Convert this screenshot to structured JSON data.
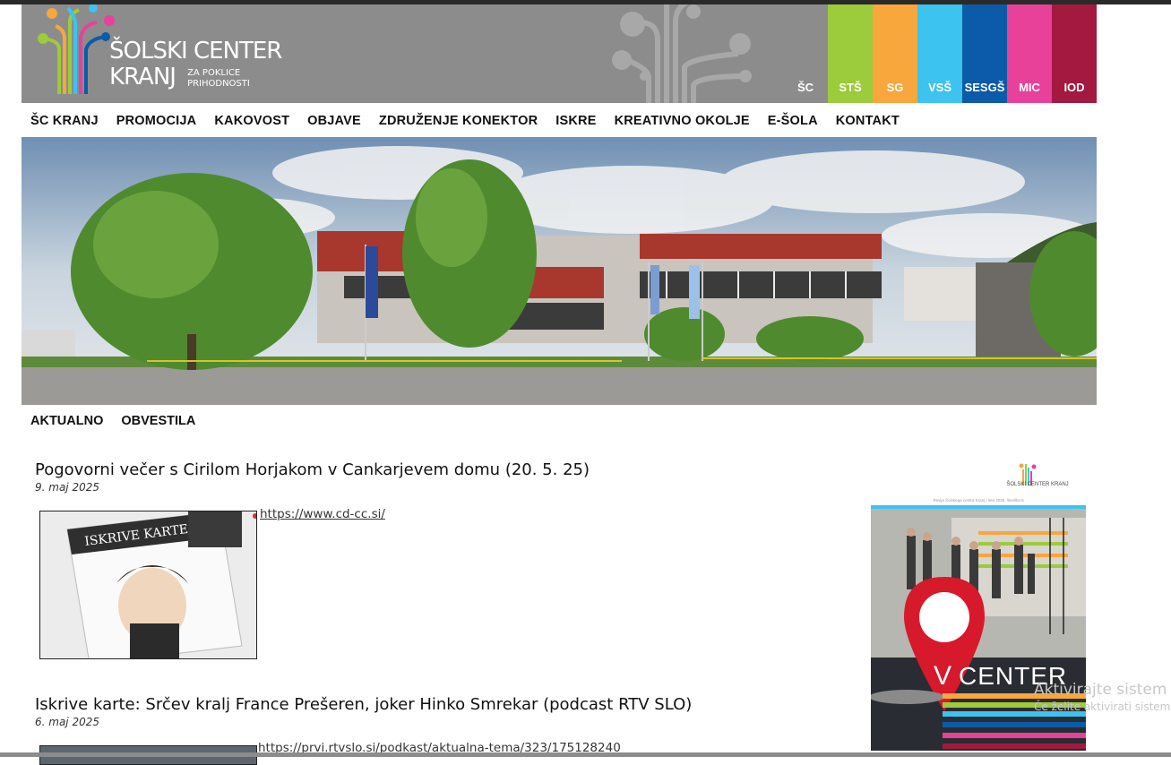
{
  "brand": {
    "line1": "ŠOLSKI CENTER",
    "line2": "KRANJ",
    "tagline1": "ZA POKLICE",
    "tagline2": "PRIHODNOSTI"
  },
  "tabs": [
    {
      "label": "ŠC",
      "color": "#8c8c8c"
    },
    {
      "label": "STŠ",
      "color": "#9ccb3b"
    },
    {
      "label": "SG",
      "color": "#f7a73b"
    },
    {
      "label": "VSŠ",
      "color": "#3cc3ef"
    },
    {
      "label": "SESGŠ",
      "color": "#0b5ba8"
    },
    {
      "label": "MIC",
      "color": "#e8419a"
    },
    {
      "label": "IOD",
      "color": "#a3193f"
    }
  ],
  "nav": [
    "ŠC KRANJ",
    "PROMOCIJA",
    "KAKOVOST",
    "OBJAVE",
    "ZDRUŽENJE KONEKTOR",
    "ISKRE",
    "KREATIVNO OKOLJE",
    "E-ŠOLA",
    "KONTAKT"
  ],
  "subnav": [
    "AKTUALNO",
    "OBVESTILA"
  ],
  "posts": [
    {
      "title": "Pogovorni večer s Cirilom Horjakom v Cankarjevem domu (20. 5. 25)",
      "date": "9. maj 2025",
      "link": "https://www.cd-cc.si/",
      "thumb_text": "ISKRIVE KARTE"
    },
    {
      "title": "Iskrive karte: Srčev kralj France Prešeren, joker Hinko Smrekar (podcast RTV SLO)",
      "date": "6. maj 2025",
      "link": "https://prvi.rtvslo.si/podkast/aktualna-tema/323/175128240"
    }
  ],
  "sidebar_ad": {
    "brand": "ŠOLSKI CENTER KRANJ",
    "title_v": "V",
    "title_rest": "CENTER",
    "caption": "Revija Šolskega centra Kranj / leto 2025, številka 6"
  },
  "watermark": {
    "line1": "Aktivirajte sistem",
    "line2": "Če želite aktivirati sistem"
  },
  "colors": {
    "header_gray": "#8c8c8c",
    "text": "#111111",
    "pin_red": "#d7192c"
  }
}
